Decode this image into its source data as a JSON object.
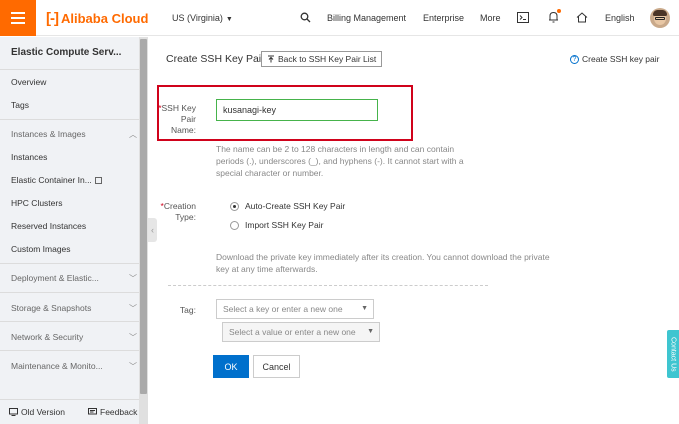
{
  "header": {
    "brand": "Alibaba Cloud",
    "region": "US (Virginia)",
    "links": [
      "Billing Management",
      "Enterprise",
      "More"
    ],
    "language": "English"
  },
  "sidebar": {
    "title": "Elastic Compute Serv...",
    "items": [
      {
        "label": "Overview",
        "type": "item"
      },
      {
        "label": "Tags",
        "type": "item"
      },
      {
        "label": "Instances & Images",
        "type": "group",
        "expanded": true
      },
      {
        "label": "Instances",
        "type": "item"
      },
      {
        "label": "Elastic Container In...",
        "type": "item",
        "external": true
      },
      {
        "label": "HPC Clusters",
        "type": "item"
      },
      {
        "label": "Reserved Instances",
        "type": "item"
      },
      {
        "label": "Custom Images",
        "type": "item"
      },
      {
        "label": "Deployment & Elastic...",
        "type": "group"
      },
      {
        "label": "Storage & Snapshots",
        "type": "group"
      },
      {
        "label": "Network & Security",
        "type": "group"
      },
      {
        "label": "Maintenance & Monito...",
        "type": "group"
      }
    ],
    "footer": {
      "old_version": "Old Version",
      "feedback": "Feedback"
    }
  },
  "main": {
    "title": "Create SSH Key Pair",
    "back_button": "Back to SSH Key Pair List",
    "help_link": "Create SSH key pair",
    "name_field": {
      "required_mark": "*",
      "label_lines": [
        "SSH Key",
        "Pair",
        "Name:"
      ],
      "value": "kusanagi-key",
      "hint_lines": [
        "The name can be 2 to 128 characters in length and can contain",
        "periods (.), underscores (_), and hyphens (-). It cannot start with a",
        "special character or number."
      ]
    },
    "creation_type": {
      "required_mark": "*",
      "label_lines": [
        "Creation",
        "Type:"
      ],
      "options": [
        {
          "label": "Auto-Create SSH Key Pair",
          "selected": true
        },
        {
          "label": "Import SSH Key Pair",
          "selected": false
        }
      ],
      "hint_lines": [
        "Download the private key immediately after its creation. You cannot download the private",
        "key at any time afterwards."
      ]
    },
    "tag": {
      "label": "Tag:",
      "key_placeholder": "Select a key or enter a new one",
      "value_placeholder": "Select a value or enter a new one"
    },
    "ok_button": "OK",
    "cancel_button": "Cancel"
  },
  "contact_tab": "Contact Us",
  "colors": {
    "brand": "#ff6a00",
    "primary": "#0070cc",
    "highlight": "#d0021b",
    "input_focus": "#46b34b",
    "contact": "#3ec5d0"
  }
}
